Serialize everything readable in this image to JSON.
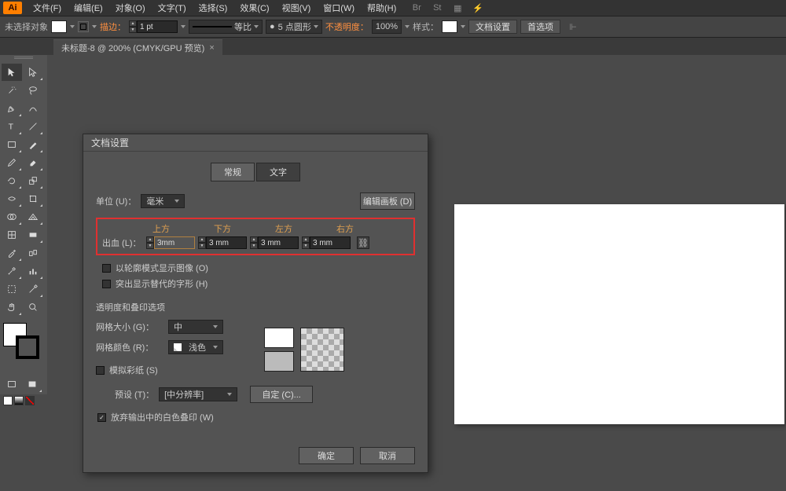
{
  "app": {
    "logo": "Ai"
  },
  "menu": {
    "items": [
      "文件(F)",
      "编辑(E)",
      "对象(O)",
      "文字(T)",
      "选择(S)",
      "效果(C)",
      "视图(V)",
      "窗口(W)",
      "帮助(H)"
    ]
  },
  "controlbar": {
    "no_selection": "未选择对象",
    "stroke_label": "描边：",
    "stroke_val": "1 pt",
    "uniform_label": "等比",
    "dotted_val": "5 点圆形",
    "opacity_label": "不透明度：",
    "opacity_val": "100%",
    "style_label": "样式：",
    "doc_setup_btn": "文档设置",
    "prefs_btn": "首选项"
  },
  "doctab": {
    "label": "未标题-8 @ 200% (CMYK/GPU 预览)",
    "close": "×"
  },
  "dialog": {
    "title": "文档设置",
    "tabs": {
      "general": "常规",
      "text": "文字"
    },
    "unit_label": "单位 (U)：",
    "unit_val": "毫米",
    "edit_artboard_btn": "编辑画板 (D)",
    "bleed": {
      "label": "出血 (L)：",
      "headers": {
        "top": "上方",
        "bottom": "下方",
        "left": "左方",
        "right": "右方"
      },
      "top": "3mm",
      "bottom_v": "3 mm",
      "left_v": "3 mm",
      "right_v": "3 mm"
    },
    "outline_mode": "以轮廓模式显示图像 (O)",
    "highlight_sub": "突出显示替代的字形 (H)",
    "trans_section": "透明度和叠印选项",
    "grid_size_label": "网格大小 (G)：",
    "grid_size_val": "中",
    "grid_color_label": "网格颜色 (R)：",
    "grid_color_val": "浅色",
    "simulate_paper": "模拟彩纸 (S)",
    "preset_label": "预设 (T)：",
    "preset_val": "[中分辨率]",
    "custom_btn": "自定 (C)...",
    "discard_white": "放弃输出中的白色叠印 (W)",
    "ok": "确定",
    "cancel": "取消"
  }
}
